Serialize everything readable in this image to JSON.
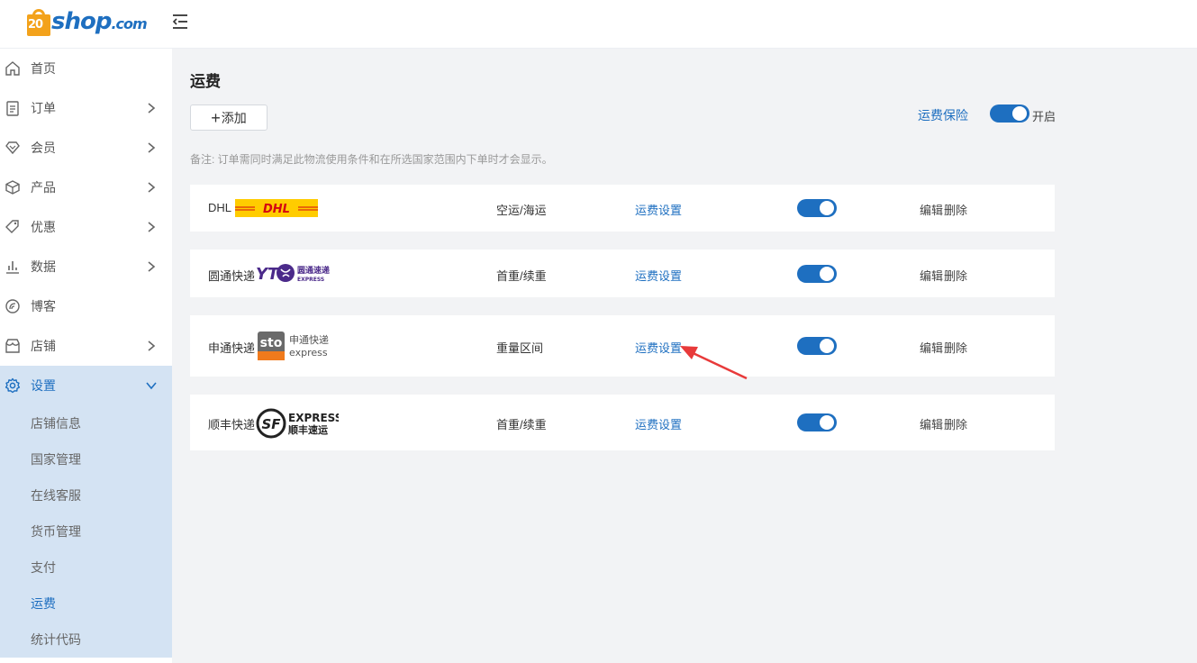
{
  "brand": {
    "badge": "20",
    "name": "shop",
    "suffix": ".com",
    "color": "#1e6fc0",
    "badge_color": "#f3a21b"
  },
  "sidebar": {
    "items": [
      {
        "label": "首页",
        "icon": "home-icon",
        "has_children": false
      },
      {
        "label": "订单",
        "icon": "order-icon",
        "has_children": true
      },
      {
        "label": "会员",
        "icon": "member-icon",
        "has_children": true
      },
      {
        "label": "产品",
        "icon": "product-icon",
        "has_children": true
      },
      {
        "label": "优惠",
        "icon": "coupon-icon",
        "has_children": true
      },
      {
        "label": "数据",
        "icon": "data-icon",
        "has_children": true
      },
      {
        "label": "博客",
        "icon": "blog-icon",
        "has_children": false
      },
      {
        "label": "店铺",
        "icon": "store-icon",
        "has_children": true
      },
      {
        "label": "设置",
        "icon": "settings-icon",
        "has_children": true,
        "expanded": true
      }
    ],
    "submenu": [
      "店铺信息",
      "国家管理",
      "在线客服",
      "货币管理",
      "支付",
      "运费",
      "统计代码"
    ],
    "current_submenu": "运费"
  },
  "page": {
    "title": "运费",
    "add_label": "添加",
    "insurance_label": "运费保险",
    "insurance_state": "开启",
    "insurance_enabled": true,
    "note": "备注: 订单需同时满足此物流使用条件和在所选国家范围内下单时才会显示。"
  },
  "carriers": [
    {
      "name": "DHL",
      "logo": "dhl-logo",
      "logo_text": "DHL",
      "method": "空运/海运",
      "fee_link": "运费设置",
      "enabled": true,
      "edit": "编辑",
      "delete": "删除"
    },
    {
      "name": "圆通快递",
      "logo": "yto-logo",
      "logo_text": "YT",
      "logo_cn": "圆通速递",
      "logo_en": "EXPRESS",
      "method": "首重/续重",
      "fee_link": "运费设置",
      "enabled": true,
      "edit": "编辑",
      "delete": "删除"
    },
    {
      "name": "申通快递",
      "logo": "sto-logo",
      "logo_text": "sto",
      "logo_cn": "申通快递",
      "logo_en": "express",
      "method": "重量区间",
      "fee_link": "运费设置",
      "enabled": true,
      "edit": "编辑",
      "delete": "删除"
    },
    {
      "name": "顺丰快递",
      "logo": "sf-logo",
      "logo_text": "SF",
      "logo_cn": "顺丰速运",
      "logo_en": "EXPRESS",
      "method": "首重/续重",
      "fee_link": "运费设置",
      "enabled": true,
      "edit": "编辑",
      "delete": "删除"
    }
  ],
  "colors": {
    "accent": "#1e6fc0",
    "sidebar_active": "#d4e3f3",
    "arrow": "#e83a3a",
    "dhl_yellow": "#ffcc00",
    "dhl_red": "#d40511"
  }
}
